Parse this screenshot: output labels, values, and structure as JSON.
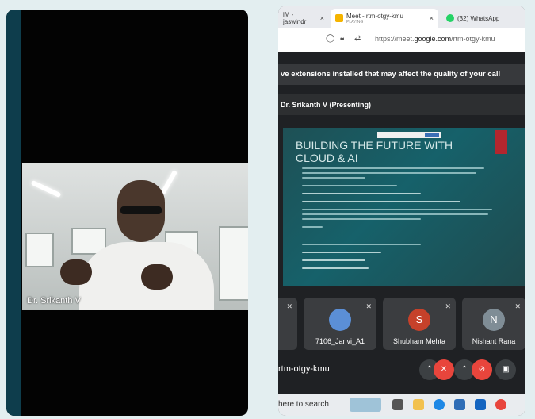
{
  "left_panel": {
    "participant_name": "Dr. Srikanth V"
  },
  "browser": {
    "tabs": [
      {
        "label": "iM - jaswindr",
        "subtitle": "",
        "icon": "gmail-icon"
      },
      {
        "label": "Meet - rtm-otgy-kmu",
        "subtitle": "PLAYING",
        "icon": "meet-icon"
      },
      {
        "label": "(32) WhatsApp",
        "subtitle": "",
        "icon": "whatsapp-icon"
      }
    ],
    "close_glyph": "×",
    "url_prefix": "https://meet.",
    "url_domain": "google.com",
    "url_path": "/rtm-otgy-kmu"
  },
  "meet": {
    "banner": "ve extensions installed that may affect the quality of your call",
    "presenting": "Dr. Srikanth V (Presenting)",
    "slide_title": "BUILDING THE FUTURE WITH CLOUD & AI",
    "participants": [
      {
        "name": "",
        "initial": "",
        "avatar_color": "#3b3d40"
      },
      {
        "name": "7106_Janvi_A1",
        "initial": "",
        "avatar_color": "#5b8fd6"
      },
      {
        "name": "Shubham Mehta",
        "initial": "S",
        "avatar_color": "#c6412a"
      },
      {
        "name": "Nishant Rana",
        "initial": "N",
        "avatar_color": "#7f8d96"
      }
    ],
    "meeting_code": "rtm-otgy-kmu",
    "accent_red": "#e8453c"
  },
  "taskbar": {
    "search_text": "here to search"
  }
}
